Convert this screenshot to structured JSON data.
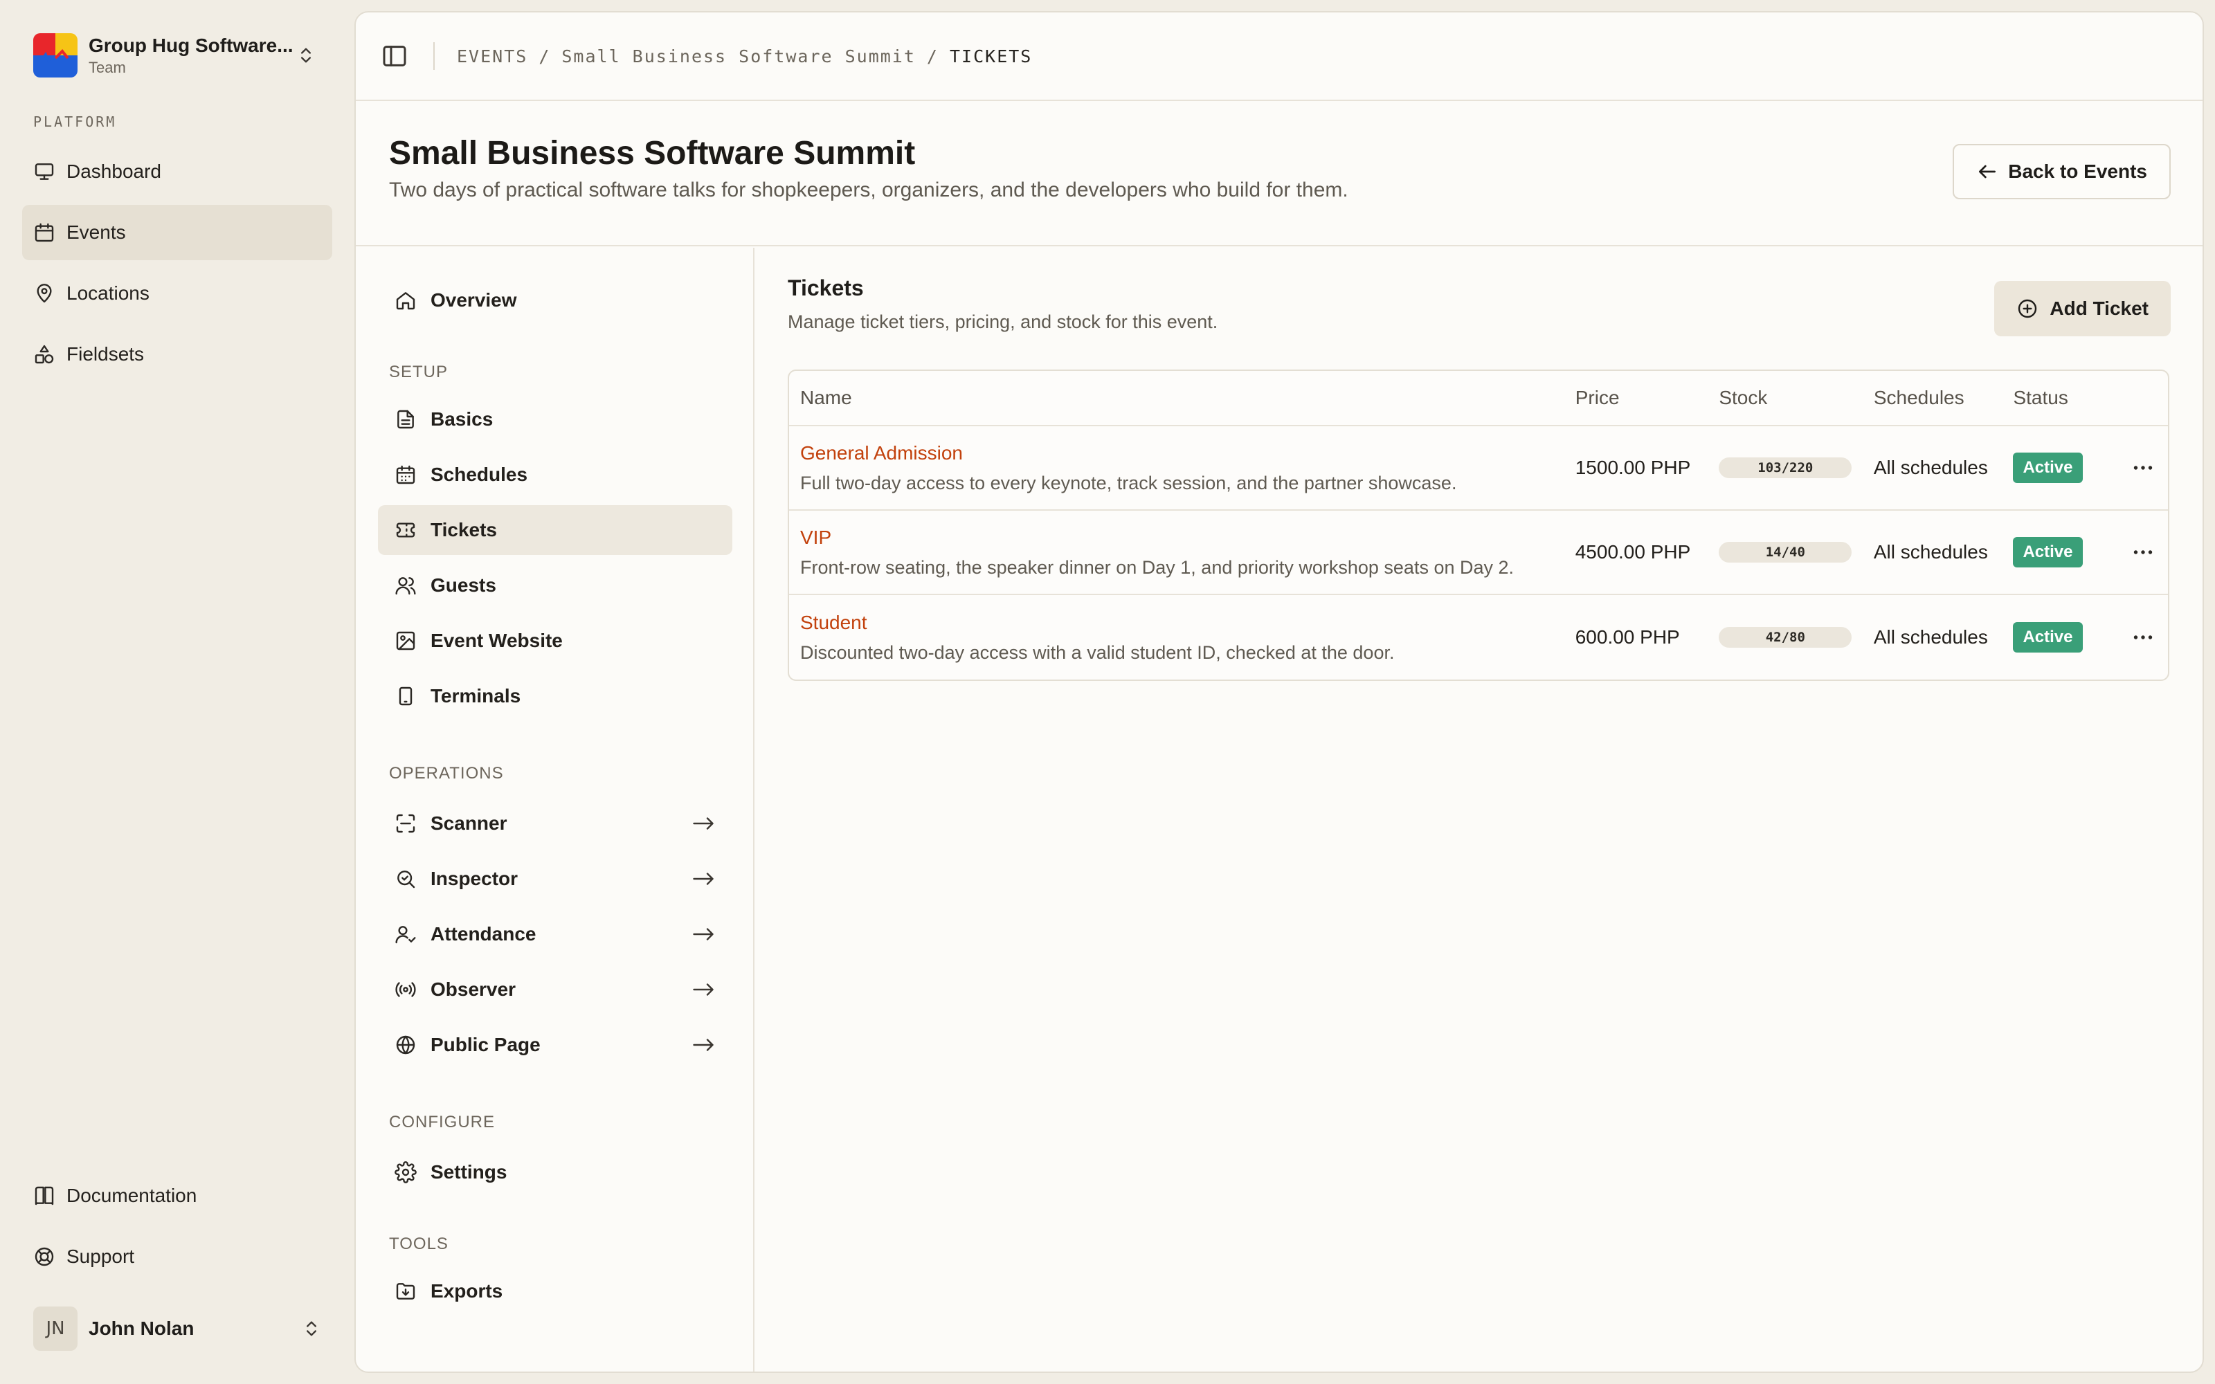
{
  "team": {
    "name": "Group Hug Software...",
    "subtitle": "Team"
  },
  "sidebar": {
    "group_label": "PLATFORM",
    "items": [
      {
        "label": "Dashboard",
        "icon": "monitor-icon"
      },
      {
        "label": "Events",
        "icon": "calendar-icon",
        "active": true
      },
      {
        "label": "Locations",
        "icon": "map-pin-icon"
      },
      {
        "label": "Fieldsets",
        "icon": "shapes-icon"
      }
    ],
    "bottom_items": [
      {
        "label": "Documentation",
        "icon": "book-icon"
      },
      {
        "label": "Support",
        "icon": "life-buoy-icon"
      }
    ]
  },
  "user": {
    "initials": "JN",
    "name": "John Nolan"
  },
  "breadcrumb": {
    "items": [
      "EVENTS",
      "Small Business Software Summit"
    ],
    "current": "TICKETS",
    "separator": "/"
  },
  "event": {
    "title": "Small Business Software Summit",
    "description": "Two days of practical software talks for shopkeepers, organizers, and the developers who build for them.",
    "back_label": "Back to Events"
  },
  "subnav": {
    "overview": "Overview",
    "setup_label": "SETUP",
    "setup": [
      "Basics",
      "Schedules",
      "Tickets",
      "Guests",
      "Event Website",
      "Terminals"
    ],
    "operations_label": "OPERATIONS",
    "operations": [
      "Scanner",
      "Inspector",
      "Attendance",
      "Observer",
      "Public Page"
    ],
    "configure_label": "CONFIGURE",
    "configure": [
      "Settings"
    ],
    "tools_label": "TOOLS",
    "tools": [
      "Exports"
    ]
  },
  "tickets": {
    "title": "Tickets",
    "subtitle": "Manage ticket tiers, pricing, and stock for this event.",
    "add_label": "Add Ticket",
    "columns": {
      "name": "Name",
      "price": "Price",
      "stock": "Stock",
      "schedules": "Schedules",
      "status": "Status"
    },
    "rows": [
      {
        "name": "General Admission",
        "description": "Full two-day access to every keynote, track session, and the partner showcase.",
        "price": "1500.00 PHP",
        "stock": "103/220",
        "schedules": "All schedules",
        "status": "Active"
      },
      {
        "name": "VIP",
        "description": "Front-row seating, the speaker dinner on Day 1, and priority workshop seats on Day 2.",
        "price": "4500.00 PHP",
        "stock": "14/40",
        "schedules": "All schedules",
        "status": "Active"
      },
      {
        "name": "Student",
        "description": "Discounted two-day access with a valid student ID, checked at the door.",
        "price": "600.00 PHP",
        "stock": "42/80",
        "schedules": "All schedules",
        "status": "Active"
      }
    ]
  },
  "colors": {
    "accent_link": "#c2410c",
    "status_active": "#3a9f78",
    "app_bg": "#f1ede4",
    "panel_bg": "#fcfbf8"
  }
}
